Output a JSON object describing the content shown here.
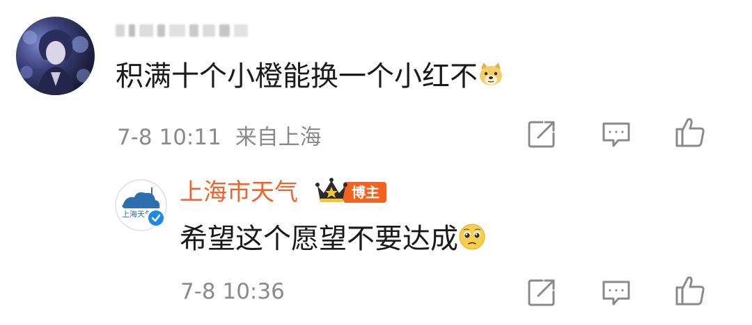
{
  "comment": {
    "text": "积满十个小橙能换一个小红不",
    "emoji_icon": "doge-emoji-icon",
    "time": "7-8 10:11",
    "location": "来自上海",
    "username_obscured": true
  },
  "reply": {
    "username": "上海市天气",
    "badge_label": "博主",
    "avatar_text": "上海天气",
    "text": "希望这个愿望不要达成",
    "emoji_icon": "pleading-face-emoji-icon",
    "time": "7-8 10:36"
  },
  "actions": {
    "share_icon": "share-icon",
    "comment_icon": "comment-icon",
    "like_icon": "thumbs-up-icon"
  },
  "colors": {
    "username_orange": "#f0622c",
    "badge_orange": "#f5621f",
    "meta_gray": "#8a8a8a",
    "text_dark": "#1a1a1a",
    "verified_blue": "#1e88e5"
  }
}
